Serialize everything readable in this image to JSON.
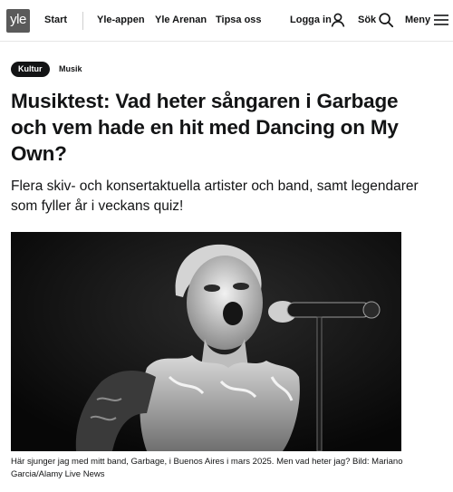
{
  "header": {
    "logo_text": "yle",
    "nav": [
      "Start",
      "Yle-appen",
      "Yle Arenan",
      "Tipsa oss"
    ],
    "login_label": "Logga in",
    "search_label": "Sök",
    "menu_label": "Meny"
  },
  "article": {
    "category_tag": "Kultur",
    "subcategory_tag": "Musik",
    "headline": "Musiktest: Vad heter sångaren i Garbage och vem hade en hit med Dancing on My Own?",
    "lead": "Flera skiv- och konsertaktuella artister och band, samt legendarer som fyller år i veckans quiz!",
    "image_caption": "Här sjunger jag med mitt band, Garbage, i Buenos Aires i mars 2025. Men vad heter jag? Bild: Mariano Garcia/Alamy Live News"
  },
  "icons": {
    "login": "person-icon",
    "search": "search-icon",
    "menu": "hamburger-icon"
  }
}
